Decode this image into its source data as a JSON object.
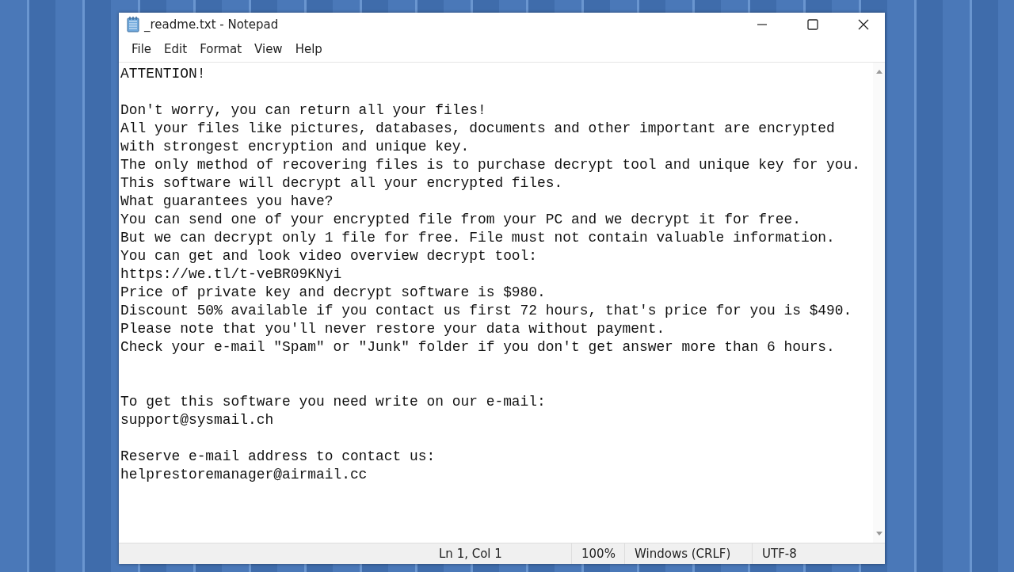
{
  "window": {
    "title": "_readme.txt - Notepad"
  },
  "menu": [
    "File",
    "Edit",
    "Format",
    "View",
    "Help"
  ],
  "editor": {
    "text": "ATTENTION!\n\nDon't worry, you can return all your files!\nAll your files like pictures, databases, documents and other important are encrypted\nwith strongest encryption and unique key.\nThe only method of recovering files is to purchase decrypt tool and unique key for you.\nThis software will decrypt all your encrypted files.\nWhat guarantees you have?\nYou can send one of your encrypted file from your PC and we decrypt it for free.\nBut we can decrypt only 1 file for free. File must not contain valuable information.\nYou can get and look video overview decrypt tool:\nhttps://we.tl/t-veBR09KNyi\nPrice of private key and decrypt software is $980.\nDiscount 50% available if you contact us first 72 hours, that's price for you is $490.\nPlease note that you'll never restore your data without payment.\nCheck your e-mail \"Spam\" or \"Junk\" folder if you don't get answer more than 6 hours.\n\n\nTo get this software you need write on our e-mail:\nsupport@sysmail.ch\n\nReserve e-mail address to contact us:\nhelprestoremanager@airmail.cc"
  },
  "status_bar": [
    "Ln 1, Col 1",
    "100%",
    "Windows (CRLF)",
    "UTF-8"
  ]
}
